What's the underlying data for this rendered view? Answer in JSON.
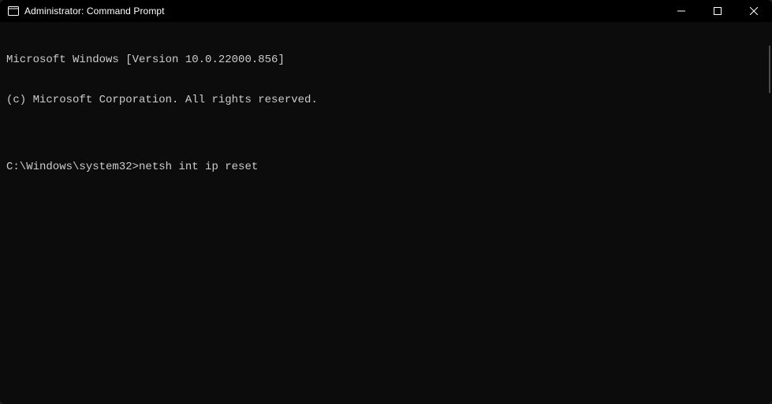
{
  "window": {
    "title": "Administrator: Command Prompt"
  },
  "terminal": {
    "line1": "Microsoft Windows [Version 10.0.22000.856]",
    "line2": "(c) Microsoft Corporation. All rights reserved.",
    "blank": "",
    "prompt": "C:\\Windows\\system32>",
    "command": "netsh int ip reset"
  }
}
